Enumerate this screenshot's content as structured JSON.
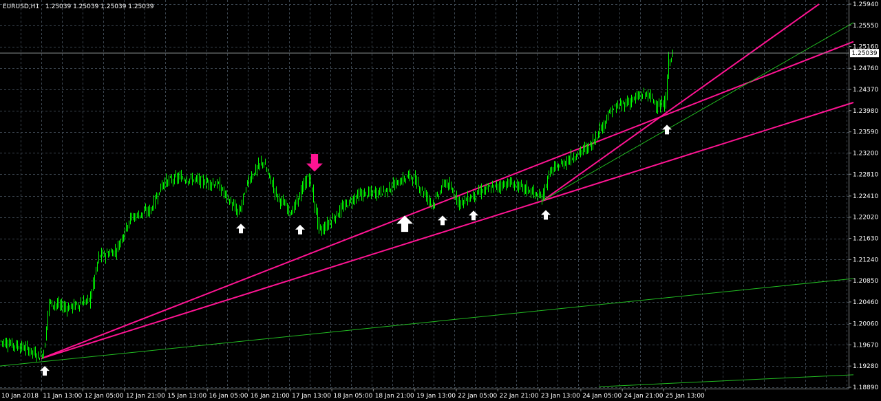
{
  "header": {
    "symbol": "EURUSD,H1",
    "ohlc": "1.25039 1.25039 1.25039 1.25039"
  },
  "price_tag": "1.25039",
  "colors": {
    "background": "#000000",
    "grid": "#3c4650",
    "candle": "#00ff00",
    "trendline_pink": "#ff1493",
    "trendline_green": "#22bb22",
    "arrow_up": "#ffffff",
    "arrow_down": "#ff1493",
    "axis_text": "#ffffff"
  },
  "chart_data": {
    "type": "candlestick",
    "symbol": "EURUSD",
    "timeframe": "H1",
    "grid": true,
    "ylim": [
      1.1889,
      1.2594
    ],
    "y_ticks": [
      "1.25940",
      "1.25550",
      "1.25160",
      "1.24760",
      "1.24370",
      "1.23980",
      "1.23590",
      "1.23200",
      "1.22810",
      "1.22410",
      "1.22020",
      "1.21630",
      "1.21240",
      "1.20850",
      "1.20460",
      "1.20060",
      "1.19670",
      "1.19280",
      "1.18890"
    ],
    "x_ticks": [
      "10 Jan 2018",
      "11 Jan 13:00",
      "12 Jan 05:00",
      "12 Jan 21:00",
      "15 Jan 13:00",
      "16 Jan 05:00",
      "16 Jan 21:00",
      "17 Jan 13:00",
      "18 Jan 05:00",
      "18 Jan 21:00",
      "19 Jan 13:00",
      "22 Jan 05:00",
      "22 Jan 21:00",
      "23 Jan 13:00",
      "24 Jan 05:00",
      "24 Jan 21:00",
      "25 Jan 13:00"
    ],
    "current_price": 1.25039,
    "price_path": [
      [
        0,
        1.1975
      ],
      [
        40,
        1.196
      ],
      [
        60,
        1.1945
      ],
      [
        66,
        1.196
      ],
      [
        72,
        1.2045
      ],
      [
        100,
        1.2035
      ],
      [
        132,
        1.205
      ],
      [
        145,
        1.213
      ],
      [
        170,
        1.214
      ],
      [
        190,
        1.22
      ],
      [
        220,
        1.2215
      ],
      [
        238,
        1.2265
      ],
      [
        260,
        1.2275
      ],
      [
        290,
        1.227
      ],
      [
        318,
        1.2262
      ],
      [
        348,
        1.2208
      ],
      [
        362,
        1.227
      ],
      [
        383,
        1.2305
      ],
      [
        404,
        1.224
      ],
      [
        425,
        1.221
      ],
      [
        450,
        1.228
      ],
      [
        466,
        1.2175
      ],
      [
        500,
        1.222
      ],
      [
        520,
        1.2242
      ],
      [
        560,
        1.225
      ],
      [
        598,
        1.228
      ],
      [
        630,
        1.2225
      ],
      [
        648,
        1.2268
      ],
      [
        670,
        1.2228
      ],
      [
        700,
        1.225
      ],
      [
        740,
        1.2265
      ],
      [
        770,
        1.2252
      ],
      [
        788,
        1.2235
      ],
      [
        800,
        1.2285
      ],
      [
        830,
        1.231
      ],
      [
        860,
        1.2335
      ],
      [
        890,
        1.24
      ],
      [
        940,
        1.243
      ],
      [
        960,
        1.2405
      ],
      [
        968,
        1.241
      ],
      [
        973,
        1.249
      ],
      [
        978,
        1.25
      ]
    ],
    "trend_lines": [
      {
        "color": "pink",
        "from": [
          60,
          1.1942
        ],
        "to": [
          1240,
          1.2525
        ]
      },
      {
        "color": "pink",
        "from": [
          60,
          1.1942
        ],
        "to": [
          788,
          1.2232
        ]
      },
      {
        "color": "pink",
        "from": [
          788,
          1.2232
        ],
        "to": [
          1190,
          1.2594
        ]
      },
      {
        "color": "pink",
        "from": [
          788,
          1.2232
        ],
        "to": [
          1240,
          1.2413
        ]
      },
      {
        "color": "green",
        "from": [
          0,
          1.1928
        ],
        "to": [
          1240,
          1.2089
        ]
      },
      {
        "color": "green",
        "from": [
          788,
          1.2232
        ],
        "to": [
          1240,
          1.256
        ]
      },
      {
        "color": "green",
        "from": [
          870,
          1.189
        ],
        "to": [
          1240,
          1.1912
        ]
      }
    ],
    "up_arrows": [
      {
        "x": 65,
        "price": 1.1928,
        "size": "small"
      },
      {
        "x": 350,
        "price": 1.219,
        "size": "small"
      },
      {
        "x": 436,
        "price": 1.2188,
        "size": "small"
      },
      {
        "x": 588,
        "price": 1.2205,
        "size": "large"
      },
      {
        "x": 643,
        "price": 1.2205,
        "size": "small"
      },
      {
        "x": 688,
        "price": 1.2214,
        "size": "small"
      },
      {
        "x": 793,
        "price": 1.2215,
        "size": "small"
      },
      {
        "x": 969,
        "price": 1.2372,
        "size": "small"
      }
    ],
    "down_arrows": [
      {
        "x": 457,
        "price": 1.2318,
        "size": "large"
      }
    ]
  }
}
